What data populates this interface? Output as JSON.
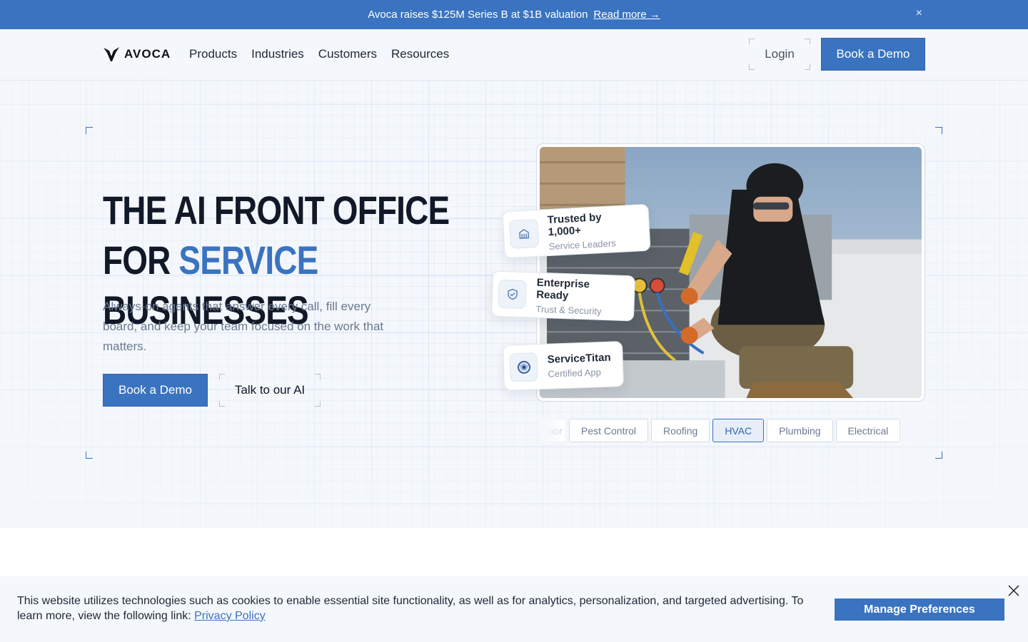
{
  "announcement": {
    "text": "Avoca raises $125M Series B at $1B valuation",
    "link": "Read more →",
    "close": "×"
  },
  "nav": {
    "logo": "AVOCA",
    "menu": [
      "Products",
      "Industries",
      "Customers",
      "Resources"
    ],
    "login": "Login",
    "cta": "Book a Demo"
  },
  "hero": {
    "headline_line1": "THE AI FRONT OFFICE",
    "headline_for": "FOR ",
    "headline_accent": "SERVICE",
    "headline_rest": " BUSINESSES",
    "subtitle": "Always-on agents that answer every call, fill every board, and keep your team focused on the work that matters.",
    "primary_cta": "Book a Demo",
    "secondary_cta": "Talk to our AI"
  },
  "badges": [
    {
      "title": "Trusted by 1,000+",
      "subtitle": "Service Leaders",
      "icon": "building-icon"
    },
    {
      "title": "Enterprise Ready",
      "subtitle": "Trust & Security",
      "icon": "shield-icon"
    },
    {
      "title": "ServiceTitan",
      "subtitle": "Certified App",
      "icon": "servicetitan-icon"
    }
  ],
  "industries": {
    "items": [
      "oor",
      "Pest Control",
      "Roofing",
      "HVAC",
      "Plumbing",
      "Electrical"
    ],
    "selected": "HVAC"
  },
  "cookie": {
    "text": "This website utilizes technologies such as cookies to enable essential site functionality, as well as for analytics, personalization, and targeted advertising. To learn more, view the following link: ",
    "link": "Privacy Policy",
    "button": "Manage Preferences"
  },
  "colors": {
    "brand": "#3a73c0",
    "text_dark": "#111827",
    "text_muted": "#6b7a90"
  }
}
